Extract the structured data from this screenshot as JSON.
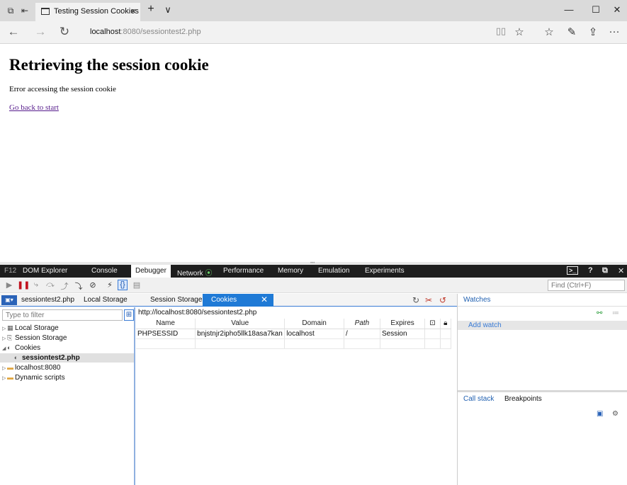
{
  "browser": {
    "tab_title": "Testing Session Cookies",
    "tab_close": "×",
    "new_tab": "+",
    "tab_menu": "∨",
    "minimize": "—",
    "maximize": "☐",
    "close": "✕",
    "back": "←",
    "forward": "→",
    "refresh": "↻",
    "url_host": "localhost",
    "url_rest": ":8080/sessiontest2.php",
    "more": "···"
  },
  "page": {
    "heading": "Retrieving the session cookie",
    "message": "Error accessing the session cookie",
    "link": "Go back to start"
  },
  "devtools": {
    "tabs": {
      "f12": "F12",
      "dom": "DOM Explorer",
      "console": "Console",
      "debugger": "Debugger",
      "network": "Network",
      "performance": "Performance",
      "memory": "Memory",
      "emulation": "Emulation",
      "experiments": "Experiments"
    },
    "help": "?",
    "find_placeholder": "Find (Ctrl+F)",
    "doc_tabs": {
      "file": "sessiontest2.php",
      "local": "Local Storage",
      "session": "Session Storage",
      "cookies": "Cookies",
      "close": "✕"
    },
    "filter_placeholder": "Type to filter",
    "tree": {
      "local_storage": "Local Storage",
      "session_storage": "Session Storage",
      "cookies": "Cookies",
      "cookie_page": "sessiontest2.php",
      "localhost": "localhost:8080",
      "dynamic": "Dynamic scripts"
    },
    "cookie_url": "http://localhost:8080/sessiontest2.php",
    "columns": {
      "name": "Name",
      "value": "Value",
      "domain": "Domain",
      "path": "Path",
      "expires": "Expires"
    },
    "cookie": {
      "name": "PHPSESSID",
      "value": "bnjstnjr2ipho5llk18asa7kan",
      "domain": "localhost",
      "path": "/",
      "expires": "Session"
    },
    "watches_title": "Watches",
    "add_watch": "Add watch",
    "callstack_tab": "Call stack",
    "breakpoints_tab": "Breakpoints"
  }
}
